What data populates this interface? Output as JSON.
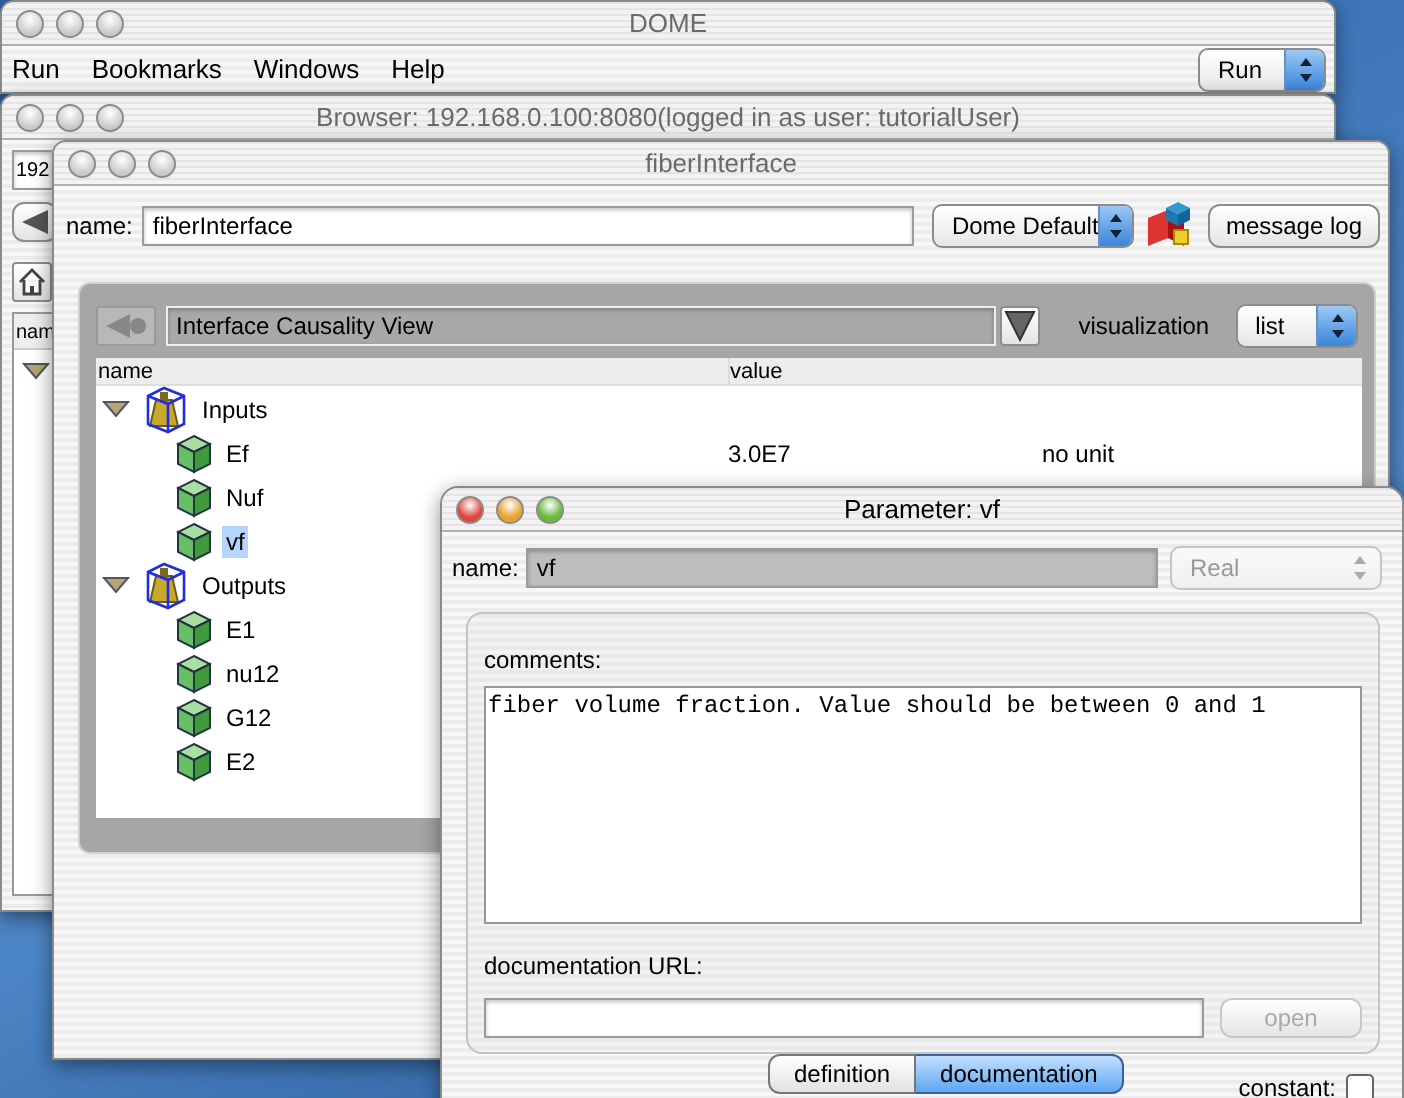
{
  "dome_window": {
    "title": "DOME",
    "active": false,
    "menu": [
      "Run",
      "Bookmarks",
      "Windows",
      "Help"
    ],
    "mode_select": {
      "value": "Run"
    }
  },
  "browser_window": {
    "title": "Browser: 192.168.0.100:8080(logged in as user: tutorialUser)",
    "active": false,
    "address_field": {
      "value": "192"
    },
    "list_header": "nam",
    "root_expanded": true
  },
  "interface_window": {
    "title": "fiberInterface",
    "active": false,
    "name_label": "name:",
    "name_value": "fiberInterface",
    "style_select": {
      "value": "Dome Default"
    },
    "message_log_button": "message log",
    "view_select": {
      "value": "Interface Causality View"
    },
    "visualization_label": "visualization",
    "visualization_select": {
      "value": "list"
    },
    "table": {
      "columns": [
        "name",
        "value"
      ],
      "rows": [
        {
          "name": "Inputs",
          "kind": "group",
          "expanded": true,
          "children": [
            {
              "name": "Ef",
              "kind": "parameter",
              "selected": false,
              "value": "3.0E7",
              "unit": "no unit"
            },
            {
              "name": "Nuf",
              "kind": "parameter",
              "selected": false
            },
            {
              "name": "vf",
              "kind": "parameter",
              "selected": true
            }
          ]
        },
        {
          "name": "Outputs",
          "kind": "group",
          "expanded": true,
          "children": [
            {
              "name": "E1",
              "kind": "parameter",
              "selected": false
            },
            {
              "name": "nu12",
              "kind": "parameter",
              "selected": false
            },
            {
              "name": "G12",
              "kind": "parameter",
              "selected": false
            },
            {
              "name": "E2",
              "kind": "parameter",
              "selected": false
            }
          ]
        }
      ]
    }
  },
  "parameter_window": {
    "title": "Parameter: vf",
    "active": true,
    "name_label": "name:",
    "name_value": "vf",
    "type_select": {
      "value": "Real",
      "disabled": true
    },
    "comments_label": "comments:",
    "comments": "fiber volume fraction. Value should be between 0 and 1",
    "doc_url_label": "documentation URL:",
    "open_button": {
      "label": "open",
      "disabled": true
    },
    "tabs": [
      {
        "label": "definition",
        "selected": false
      },
      {
        "label": "documentation",
        "selected": true
      }
    ],
    "constant": {
      "label": "constant:",
      "checked": false
    }
  }
}
